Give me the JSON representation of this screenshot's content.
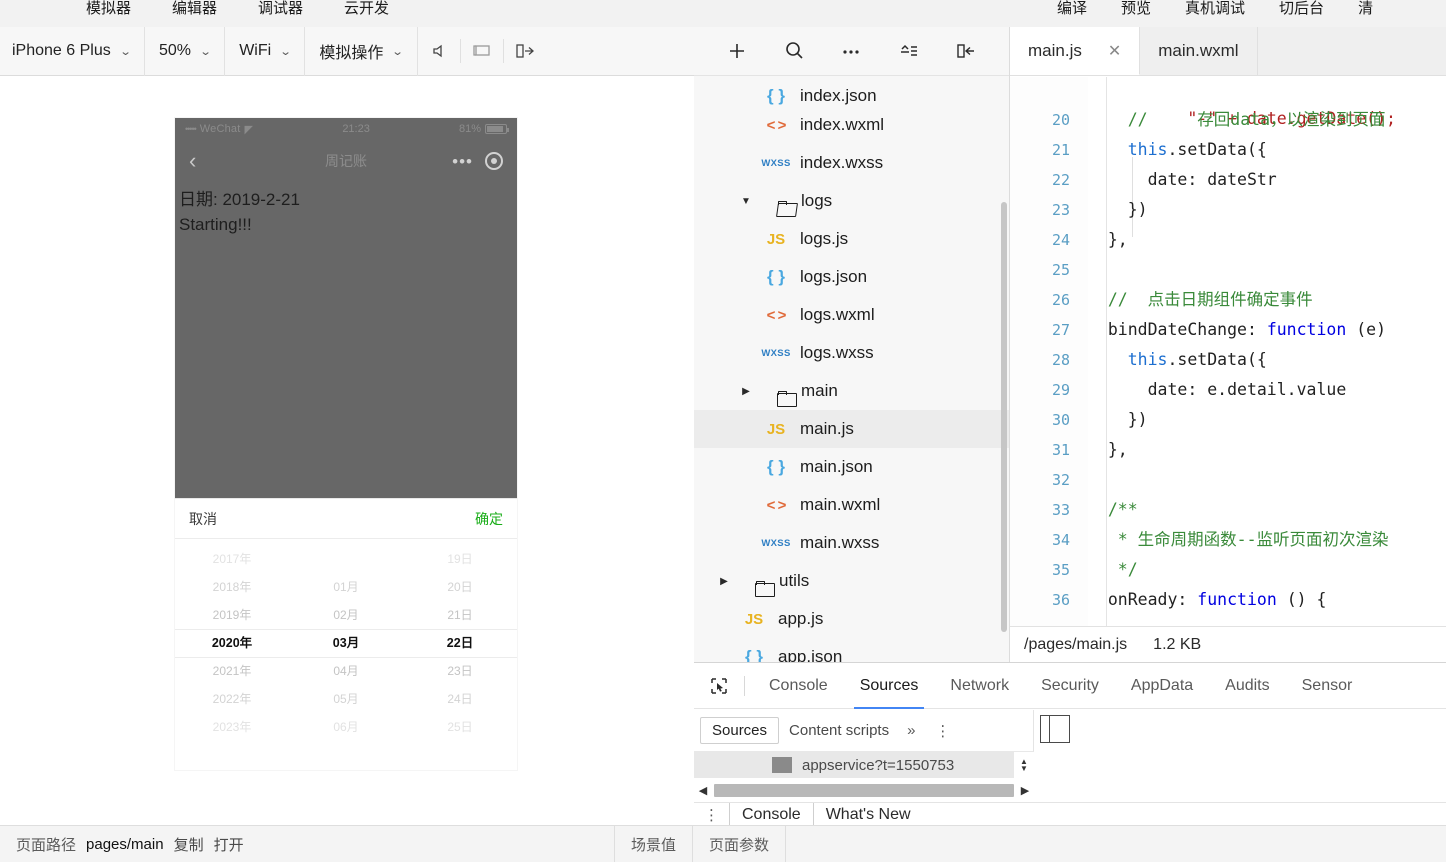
{
  "menubar": {
    "left_items": [
      "模拟器",
      "编辑器",
      "调试器",
      "云开发"
    ],
    "right_items": [
      "编译",
      "预览",
      "真机调试",
      "切后台",
      "清"
    ]
  },
  "simulator_toolbar": {
    "device": "iPhone 6 Plus",
    "zoom": "50%",
    "network": "WiFi",
    "simulate": "模拟操作",
    "caret": "⌄",
    "icons": [
      "mute-icon",
      "screen-icon",
      "panel-right-icon"
    ]
  },
  "phone": {
    "statusbar": {
      "dots": "•••••",
      "carrier": "WeChat",
      "wifi_glyph": "◤",
      "time": "21:23",
      "battery_percent": "81%"
    },
    "navbar": {
      "back_glyph": "‹",
      "title": "周记账",
      "dots": "•••",
      "capsule": "target-icon"
    },
    "content": {
      "date_line": "日期: 2019-2-21",
      "status_line": "Starting!!!"
    },
    "picker": {
      "cancel": "取消",
      "confirm": "确定",
      "years": [
        "2017年",
        "2018年",
        "2019年",
        "2020年",
        "2021年",
        "2022年",
        "2023年"
      ],
      "months": [
        "",
        "01月",
        "02月",
        "03月",
        "04月",
        "05月",
        "06月"
      ],
      "days": [
        "19日",
        "20日",
        "21日",
        "22日",
        "23日",
        "24日",
        "25日"
      ],
      "selected_index": 3,
      "selected_year": "2020年",
      "selected_month": "03月",
      "selected_day": "22日"
    }
  },
  "bottom_bar": {
    "page_path_label": "页面路径",
    "page_path_value": "pages/main",
    "copy": "复制",
    "open": "打开",
    "scene_value": "场景值",
    "page_params": "页面参数"
  },
  "explorer": {
    "toolbar_icons": [
      "add-icon",
      "search-icon",
      "more-icon",
      "collapse-all-icon",
      "panel-left-icon"
    ],
    "items": [
      {
        "label": "index.json",
        "icon": "json",
        "indent": 2,
        "type": "file",
        "clipped": true
      },
      {
        "label": "index.wxml",
        "icon": "wxml",
        "indent": 2,
        "type": "file"
      },
      {
        "label": "index.wxss",
        "icon": "wxss",
        "indent": 2,
        "type": "file"
      },
      {
        "label": "logs",
        "icon": "folder-open",
        "indent": 1,
        "type": "folder",
        "twist": "▼"
      },
      {
        "label": "logs.js",
        "icon": "js",
        "indent": 2,
        "type": "file"
      },
      {
        "label": "logs.json",
        "icon": "json",
        "indent": 2,
        "type": "file"
      },
      {
        "label": "logs.wxml",
        "icon": "wxml",
        "indent": 2,
        "type": "file"
      },
      {
        "label": "logs.wxss",
        "icon": "wxss",
        "indent": 2,
        "type": "file"
      },
      {
        "label": "main",
        "icon": "folder",
        "indent": 1,
        "type": "folder",
        "twist": "▶"
      },
      {
        "label": "main.js",
        "icon": "js",
        "indent": 2,
        "type": "file",
        "active": true
      },
      {
        "label": "main.json",
        "icon": "json",
        "indent": 2,
        "type": "file"
      },
      {
        "label": "main.wxml",
        "icon": "wxml",
        "indent": 2,
        "type": "file"
      },
      {
        "label": "main.wxss",
        "icon": "wxss",
        "indent": 2,
        "type": "file"
      },
      {
        "label": "utils",
        "icon": "folder",
        "indent": 0,
        "type": "folder",
        "twist": "▶"
      },
      {
        "label": "app.js",
        "icon": "js",
        "indent": 1,
        "type": "file"
      },
      {
        "label": "app.json",
        "icon": "json",
        "indent": 1,
        "type": "file"
      }
    ]
  },
  "editor": {
    "tabs": [
      {
        "label": "main.js",
        "active": true,
        "closable": true,
        "close_glyph": "✕"
      },
      {
        "label": "main.wxml",
        "active": false,
        "closable": false
      }
    ],
    "first_partial_line": "\"-\" + date.getDate();",
    "lines": [
      {
        "no": "20",
        "tokens": [
          {
            "t": "    //     存回data，以渲染到页面",
            "c": "com"
          }
        ]
      },
      {
        "no": "21",
        "tokens": [
          {
            "t": "    ",
            "c": "plain"
          },
          {
            "t": "this",
            "c": "this"
          },
          {
            "t": ".setData({",
            "c": "plain"
          }
        ]
      },
      {
        "no": "22",
        "tokens": [
          {
            "t": "      date: dateStr",
            "c": "plain"
          }
        ]
      },
      {
        "no": "23",
        "tokens": [
          {
            "t": "    })",
            "c": "plain"
          }
        ]
      },
      {
        "no": "24",
        "tokens": [
          {
            "t": "  },",
            "c": "plain"
          }
        ]
      },
      {
        "no": "25",
        "tokens": [
          {
            "t": "",
            "c": "plain"
          }
        ]
      },
      {
        "no": "26",
        "tokens": [
          {
            "t": "  //  点击日期组件确定事件",
            "c": "com"
          }
        ]
      },
      {
        "no": "27",
        "tokens": [
          {
            "t": "  bindDateChange: ",
            "c": "plain"
          },
          {
            "t": "function",
            "c": "kw"
          },
          {
            "t": " (e) ",
            "c": "plain"
          }
        ]
      },
      {
        "no": "28",
        "tokens": [
          {
            "t": "    ",
            "c": "plain"
          },
          {
            "t": "this",
            "c": "this"
          },
          {
            "t": ".setData({",
            "c": "plain"
          }
        ]
      },
      {
        "no": "29",
        "tokens": [
          {
            "t": "      date: e.detail.value",
            "c": "plain"
          }
        ]
      },
      {
        "no": "30",
        "tokens": [
          {
            "t": "    })",
            "c": "plain"
          }
        ]
      },
      {
        "no": "31",
        "tokens": [
          {
            "t": "  },",
            "c": "plain"
          }
        ]
      },
      {
        "no": "32",
        "tokens": [
          {
            "t": "",
            "c": "plain"
          }
        ]
      },
      {
        "no": "33",
        "tokens": [
          {
            "t": "  /**",
            "c": "com"
          }
        ]
      },
      {
        "no": "34",
        "tokens": [
          {
            "t": "   * 生命周期函数--监听页面初次渲染",
            "c": "com"
          }
        ]
      },
      {
        "no": "35",
        "tokens": [
          {
            "t": "   */",
            "c": "com"
          }
        ]
      },
      {
        "no": "36",
        "tokens": [
          {
            "t": "  onReady: ",
            "c": "plain"
          },
          {
            "t": "function",
            "c": "kw"
          },
          {
            "t": " () {",
            "c": "plain"
          }
        ]
      }
    ],
    "status": {
      "path": "/pages/main.js",
      "size": "1.2 KB"
    }
  },
  "devtools": {
    "cursor_icon": "inspect-cursor-icon",
    "tabs": [
      {
        "label": "Console",
        "active": false
      },
      {
        "label": "Sources",
        "active": true
      },
      {
        "label": "Network",
        "active": false
      },
      {
        "label": "Security",
        "active": false
      },
      {
        "label": "AppData",
        "active": false
      },
      {
        "label": "Audits",
        "active": false
      },
      {
        "label": "Sensor",
        "active": false
      }
    ],
    "subtabs": [
      {
        "label": "Sources",
        "active": true
      },
      {
        "label": "Content scripts",
        "active": false
      }
    ],
    "overflow_glyph": "»",
    "kebab_glyph": "⋮",
    "file_entry": "appservice?t=1550753",
    "scroll_up_glyph": "▲",
    "scroll_down_glyph": "▼",
    "left_arrow_glyph": "◀",
    "right_arrow_glyph": "▶",
    "drawer_tabs": [
      {
        "label": "Console",
        "active": true
      },
      {
        "label": "What's New",
        "active": false
      }
    ]
  },
  "colors": {
    "accent_blue": "#4285f4",
    "wechat_green": "#1aad19",
    "phone_overlay": "#676767",
    "js_yellow": "#e8b321",
    "json_blue": "#4aa8e0",
    "wxml_orange": "#e06a3a",
    "wxss_blue": "#2f7fc4"
  }
}
